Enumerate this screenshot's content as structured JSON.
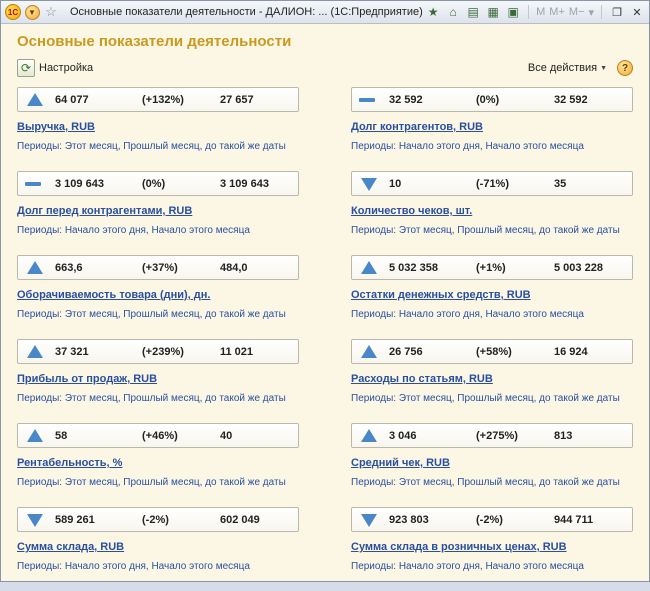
{
  "window": {
    "title": "Основные показатели деятельности - ДАЛИОН: ... (1С:Предприятие)",
    "logo_text": "1С",
    "toolbar_text": [
      "M",
      "M+",
      "M−"
    ]
  },
  "page": {
    "title": "Основные показатели деятельности",
    "settings_label": "Настройка",
    "all_actions_label": "Все действия",
    "help_label": "?"
  },
  "metrics": [
    {
      "current": "64 077",
      "percent": "(+132%)",
      "previous": "27 657",
      "trend": "up",
      "title": "Выручка, RUB",
      "periods": "Периоды: Этот месяц, Прошлый месяц, до такой же даты"
    },
    {
      "current": "32 592",
      "percent": "(0%)",
      "previous": "32 592",
      "trend": "flat",
      "title": "Долг контрагентов, RUB",
      "periods": "Периоды: Начало этого дня, Начало этого месяца"
    },
    {
      "current": "3 109 643",
      "percent": "(0%)",
      "previous": "3 109 643",
      "trend": "flat",
      "title": "Долг перед контрагентами, RUB",
      "periods": "Периоды: Начало этого дня, Начало этого месяца"
    },
    {
      "current": "10",
      "percent": "(-71%)",
      "previous": "35",
      "trend": "down",
      "title": "Количество чеков, шт.",
      "periods": "Периоды: Этот месяц, Прошлый месяц, до такой же даты"
    },
    {
      "current": "663,6",
      "percent": "(+37%)",
      "previous": "484,0",
      "trend": "up",
      "title": "Оборачиваемость товара (дни), дн.",
      "periods": "Периоды: Этот месяц, Прошлый месяц, до такой же даты"
    },
    {
      "current": "5 032 358",
      "percent": "(+1%)",
      "previous": "5 003 228",
      "trend": "up",
      "title": "Остатки денежных средств, RUB",
      "periods": "Периоды: Начало этого дня, Начало этого месяца"
    },
    {
      "current": "37 321",
      "percent": "(+239%)",
      "previous": "11 021",
      "trend": "up",
      "title": "Прибыль от продаж, RUB",
      "periods": "Периоды: Этот месяц, Прошлый месяц, до такой же даты"
    },
    {
      "current": "26 756",
      "percent": "(+58%)",
      "previous": "16 924",
      "trend": "up",
      "title": "Расходы по статьям, RUB",
      "periods": "Периоды: Этот месяц, Прошлый месяц, до такой же даты"
    },
    {
      "current": "58",
      "percent": "(+46%)",
      "previous": "40",
      "trend": "up",
      "title": "Рентабельность, %",
      "periods": "Периоды: Этот месяц, Прошлый месяц, до такой же даты"
    },
    {
      "current": "3 046",
      "percent": "(+275%)",
      "previous": "813",
      "trend": "up",
      "title": "Средний чек, RUB",
      "periods": "Периоды: Этот месяц, Прошлый месяц, до такой же даты"
    },
    {
      "current": "589 261",
      "percent": "(-2%)",
      "previous": "602 049",
      "trend": "down",
      "title": "Сумма склада, RUB",
      "periods": "Периоды: Начало этого дня, Начало этого месяца"
    },
    {
      "current": "923 803",
      "percent": "(-2%)",
      "previous": "944 711",
      "trend": "down",
      "title": "Сумма склада в розничных ценах, RUB",
      "periods": "Периоды: Начало этого дня, Начало этого месяца"
    }
  ]
}
